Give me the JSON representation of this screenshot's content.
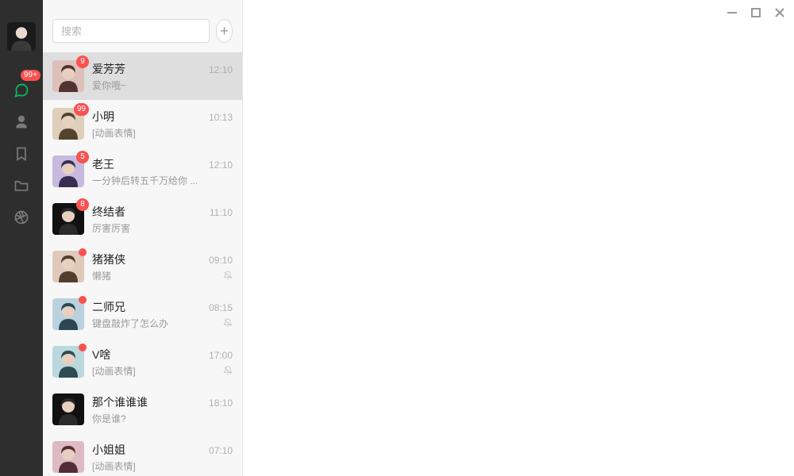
{
  "rail": {
    "chat_badge": "99+"
  },
  "search": {
    "placeholder": "搜索"
  },
  "chats": [
    {
      "name": "爱芳芳",
      "preview": "爱你哦~",
      "time": "12:10",
      "badge": "9",
      "muted": false,
      "selected": true,
      "avatar_hue": 10
    },
    {
      "name": "小明",
      "preview": "[动画表情]",
      "time": "10:13",
      "badge": "99",
      "muted": false,
      "selected": false,
      "avatar_hue": 35
    },
    {
      "name": "老王",
      "preview": "一分钟后转五千万给你 ...",
      "time": "12:10",
      "badge": "5",
      "muted": false,
      "selected": false,
      "avatar_hue": 260
    },
    {
      "name": "终结者",
      "preview": "厉害厉害",
      "time": "11:10",
      "badge": "8",
      "muted": false,
      "selected": false,
      "avatar_hue": 0
    },
    {
      "name": "猪猪侠",
      "preview": "懒猪",
      "time": "09:10",
      "dot": true,
      "muted": true,
      "selected": false,
      "avatar_hue": 25
    },
    {
      "name": "二师兄",
      "preview": "键盘敲炸了怎么办",
      "time": "08:15",
      "dot": true,
      "muted": true,
      "selected": false,
      "avatar_hue": 200
    },
    {
      "name": "V啥",
      "preview": "[动画表情]",
      "time": "17:00",
      "dot": true,
      "muted": true,
      "selected": false,
      "avatar_hue": 190
    },
    {
      "name": "那个谁谁谁",
      "preview": "你是谁?",
      "time": "18:10",
      "muted": false,
      "selected": false,
      "avatar_hue": 0
    },
    {
      "name": "小姐姐",
      "preview": "[动画表情]",
      "time": "07:10",
      "muted": false,
      "selected": false,
      "avatar_hue": 345
    }
  ]
}
